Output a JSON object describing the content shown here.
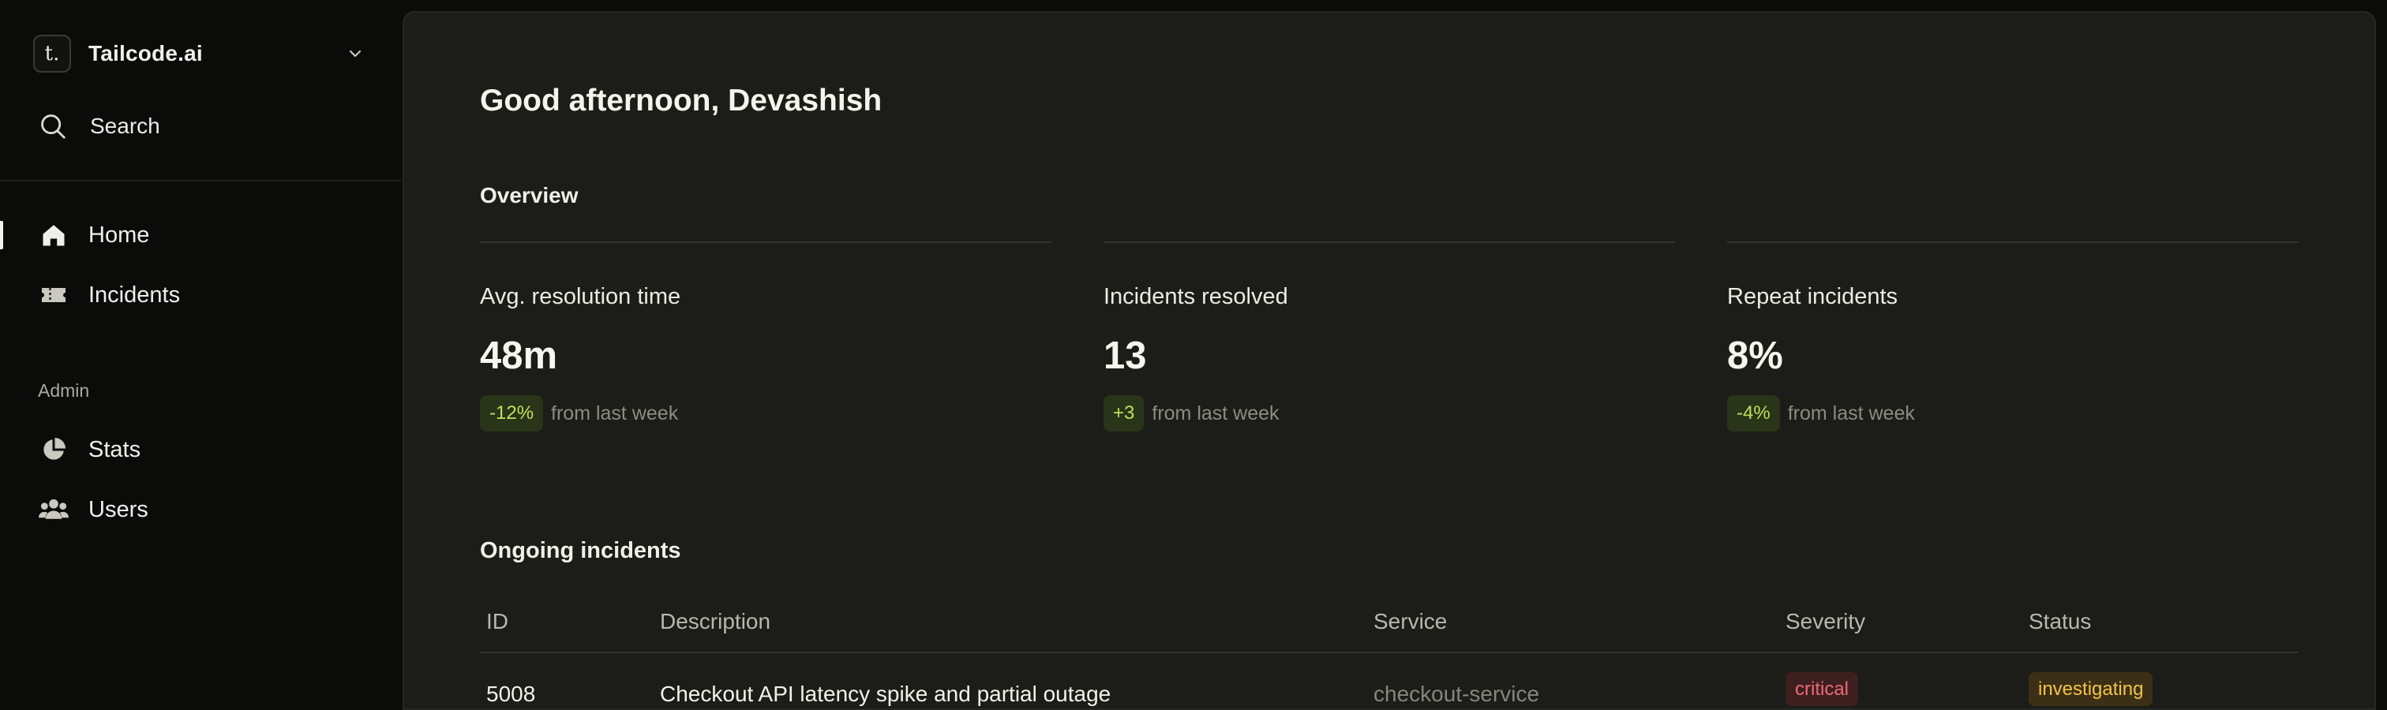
{
  "sidebar": {
    "team": {
      "logo_letter": "t.",
      "name": "Tailcode.ai"
    },
    "search_label": "Search",
    "nav": [
      {
        "label": "Home",
        "icon": "home-icon",
        "active": true
      },
      {
        "label": "Incidents",
        "icon": "ticket-icon",
        "active": false
      }
    ],
    "admin_label": "Admin",
    "admin_nav": [
      {
        "label": "Stats",
        "icon": "pie-chart-icon"
      },
      {
        "label": "Users",
        "icon": "users-icon"
      }
    ]
  },
  "main": {
    "greeting": "Good afternoon, Devashish",
    "overview_title": "Overview",
    "stats": [
      {
        "title": "Avg. resolution time",
        "value": "48m",
        "delta": "-12%",
        "delta_suffix": "from last week"
      },
      {
        "title": "Incidents resolved",
        "value": "13",
        "delta": "+3",
        "delta_suffix": "from last week"
      },
      {
        "title": "Repeat incidents",
        "value": "8%",
        "delta": "-4%",
        "delta_suffix": "from last week"
      }
    ],
    "ongoing_title": "Ongoing incidents",
    "table": {
      "headers": {
        "id": "ID",
        "description": "Description",
        "service": "Service",
        "severity": "Severity",
        "status": "Status"
      },
      "rows": [
        {
          "id": "5008",
          "description": "Checkout API latency spike and partial outage",
          "service": "checkout-service",
          "severity": "critical",
          "status": "investigating"
        }
      ]
    }
  },
  "colors": {
    "background": "#0b0b0a",
    "panel": "#1c1c18",
    "positive_badge_bg": "#2a3419",
    "positive_badge_text": "#bfe05a",
    "critical_text": "#f06b74",
    "investigating_text": "#f5c24a"
  }
}
